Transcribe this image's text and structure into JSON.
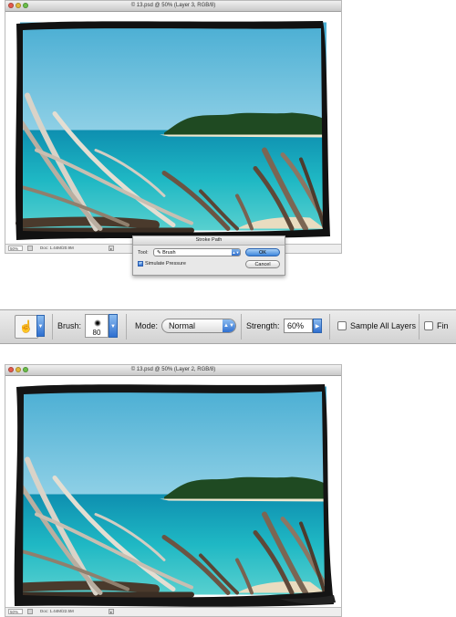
{
  "window1": {
    "title": "© 13.psd @ 50% (Layer 3, RGB/8)",
    "zoom": "50%",
    "doc_info": "Doc: 1.44M/20.9M"
  },
  "stroke_dialog": {
    "title": "Stroke Path",
    "tool_label": "Tool:",
    "tool_value": "Brush",
    "simulate_pressure_label": "Simulate Pressure",
    "simulate_pressure_checked": true,
    "ok_label": "OK",
    "cancel_label": "Cancel"
  },
  "options_bar": {
    "brush_label": "Brush:",
    "brush_size": "80",
    "mode_label": "Mode:",
    "mode_value": "Normal",
    "strength_label": "Strength:",
    "strength_value": "60%",
    "sample_all_layers_label": "Sample All Layers",
    "finger_painting_label": "Fin"
  },
  "window2": {
    "title": "© 13.psd @ 50% (Layer 2, RGB/8)",
    "zoom": "50%",
    "doc_info": "Doc: 1.44M/22.5M"
  },
  "colors": {
    "sky": "#5fb8d8",
    "sea": "#1fb3c2",
    "frame": "#111111",
    "accent_blue": "#2e6fd0"
  }
}
